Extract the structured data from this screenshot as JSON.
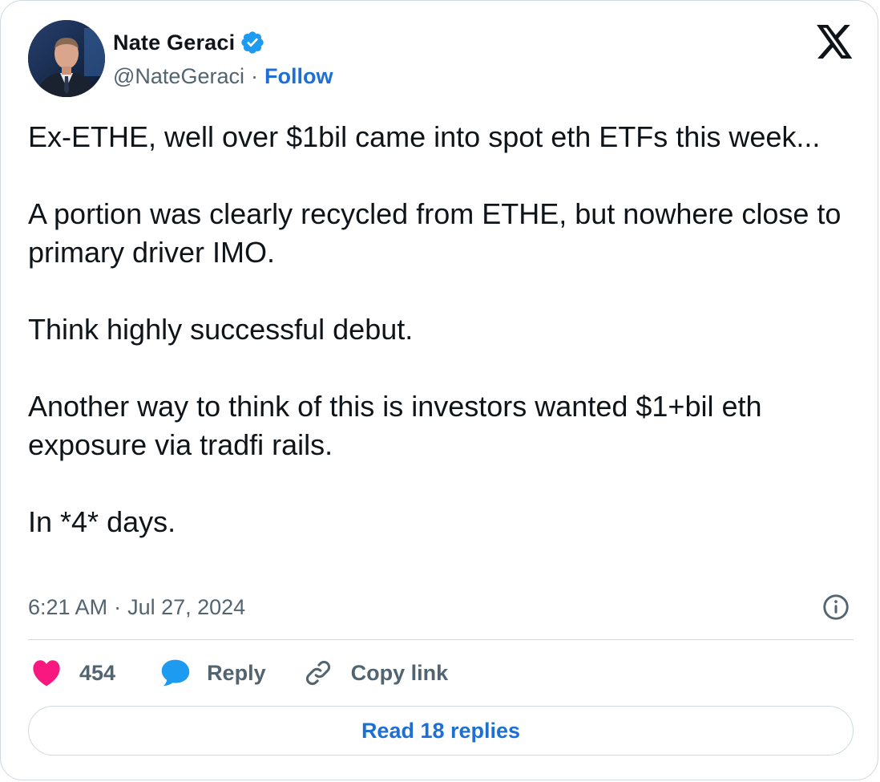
{
  "author": {
    "display_name": "Nate Geraci",
    "handle": "@NateGeraci",
    "separator": "·",
    "follow_label": "Follow",
    "verified": true
  },
  "tweet": {
    "paragraphs": [
      "Ex-ETHE, well over $1bil came into spot eth ETFs this week...",
      "A portion was clearly recycled from ETHE, but nowhere close to primary driver IMO.",
      "Think highly successful debut.",
      "Another way to think of this is investors wanted $1+bil eth exposure via tradfi rails.",
      "In *4* days."
    ],
    "time": "6:21 AM",
    "date_separator": "·",
    "date": "Jul 27, 2024"
  },
  "actions": {
    "like_count": "454",
    "reply_label": "Reply",
    "copy_link_label": "Copy link"
  },
  "read_replies_label": "Read 18 replies",
  "icons": {
    "logo": "x-logo-icon",
    "verified": "verified-badge-icon",
    "info": "info-icon",
    "like": "heart-icon",
    "reply": "speech-bubble-icon",
    "copy": "link-icon"
  },
  "colors": {
    "text": "#0f1419",
    "secondary": "#536471",
    "link": "#1d6fd6",
    "verified": "#1d9bf0",
    "like": "#f91880",
    "reply": "#1d9bf0",
    "border": "#cfd9de"
  }
}
